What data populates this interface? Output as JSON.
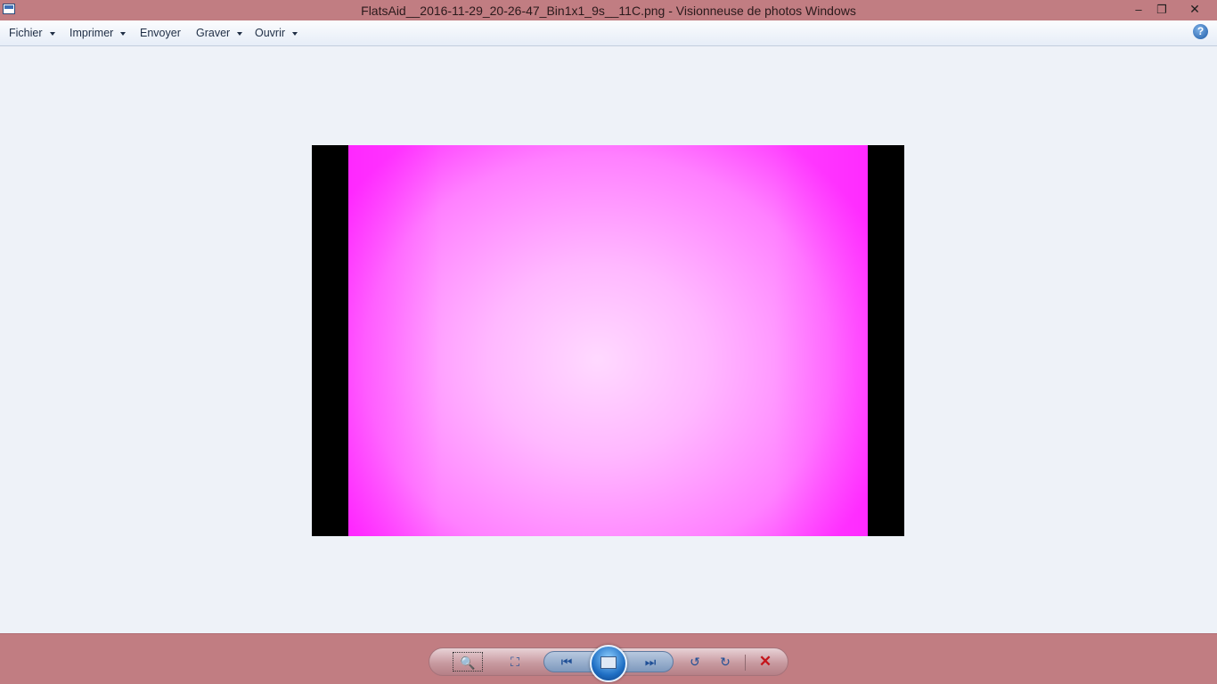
{
  "window": {
    "title": "FlatsAid__2016-11-29_20-26-47_Bin1x1_9s__11C.png - Visionneuse de photos Windows",
    "min_glyph": "–",
    "max_glyph": "❐",
    "close_glyph": "✕"
  },
  "menu": {
    "items": [
      {
        "label": "Fichier",
        "has_dropdown": true
      },
      {
        "label": "Imprimer",
        "has_dropdown": true
      },
      {
        "label": "Envoyer",
        "has_dropdown": false
      },
      {
        "label": "Graver",
        "has_dropdown": true
      },
      {
        "label": "Ouvrir",
        "has_dropdown": true
      }
    ],
    "help_glyph": "?"
  },
  "photo": {
    "content": "magenta flat field",
    "accent_color": "#ff3dff"
  },
  "controls": {
    "zoom_glyph": "🔍",
    "fit_glyph": "⛶",
    "prev_glyph": "⏮",
    "next_glyph": "⏭",
    "rotate_left_glyph": "↺",
    "rotate_right_glyph": "↻",
    "delete_glyph": "✕"
  },
  "colors": {
    "chrome": "#c17d82",
    "canvas": "#eef2f8"
  }
}
